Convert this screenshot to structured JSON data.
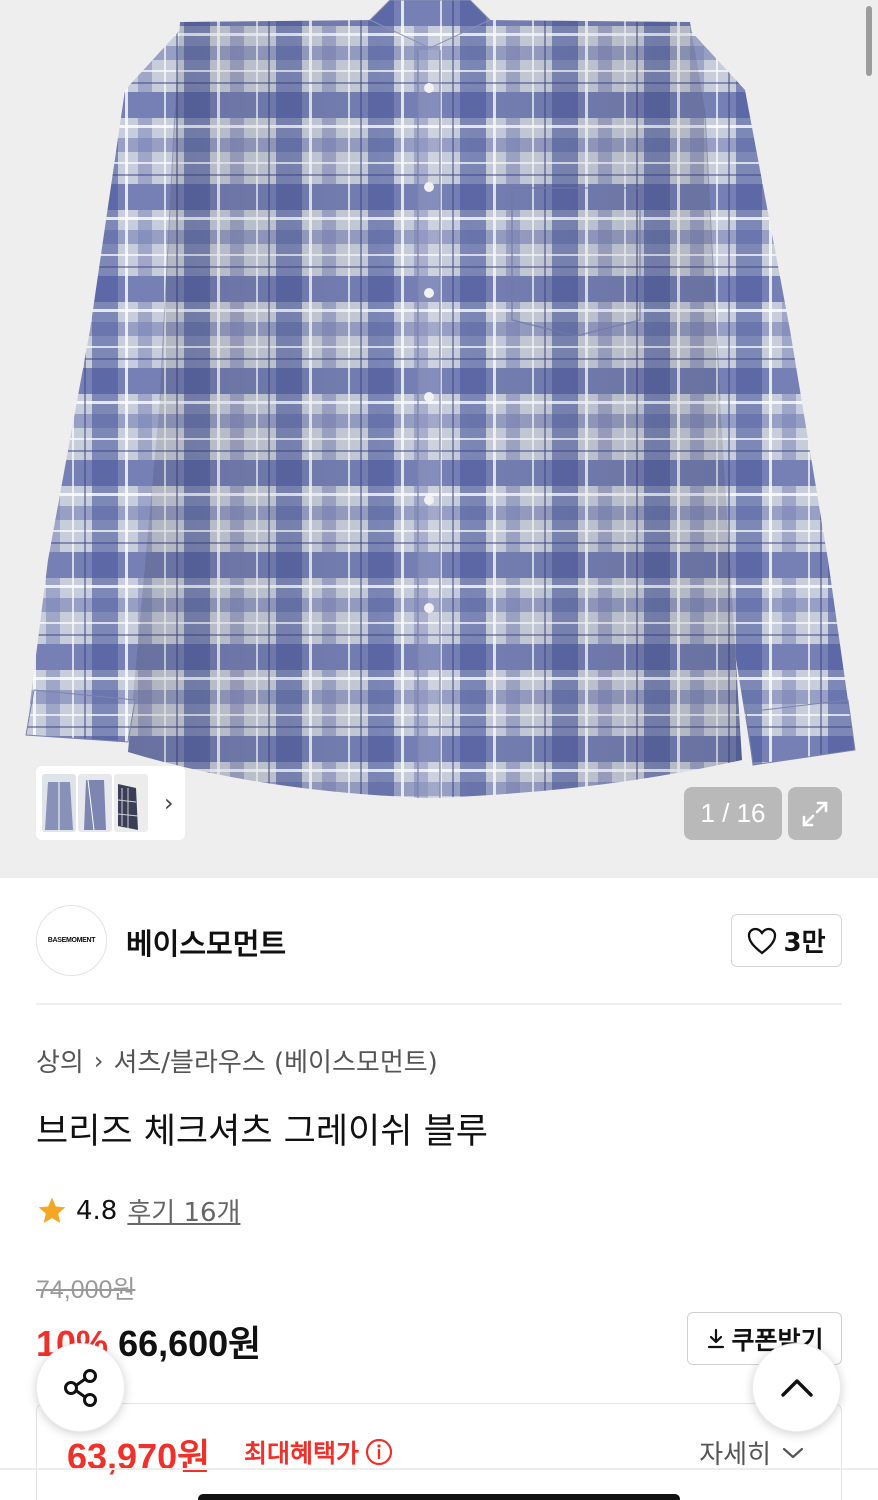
{
  "gallery": {
    "counter_current": "1",
    "counter_total": "16",
    "counter_text": "1 / 16",
    "thumb_icons": [
      "shirt-front-thumb",
      "shirt-side-thumb",
      "shirt-detail-thumb"
    ]
  },
  "brand": {
    "logo_text": "BASEMOMENT",
    "name": "베이스모먼트",
    "like_count": "3만"
  },
  "breadcrumb": {
    "category": "상의",
    "subcategory": "셔츠/블라우스 (베이스모먼트)"
  },
  "product": {
    "title": "브리즈 체크셔츠 그레이쉬 블루",
    "rating": "4.8",
    "reviews_label": "후기 16개",
    "original_price": "74,000원",
    "discount": "10%",
    "sale_price": "66,600원",
    "coupon_label": "쿠폰받기",
    "max_benefit_price": "63,970원",
    "max_benefit_label": "최대혜택가",
    "detail_label": "자세히"
  },
  "colors": {
    "accent_red": "#f0302a",
    "star": "#f5a623",
    "plaid_blue": "#4a5aa0",
    "plaid_light": "#c9ced9"
  }
}
